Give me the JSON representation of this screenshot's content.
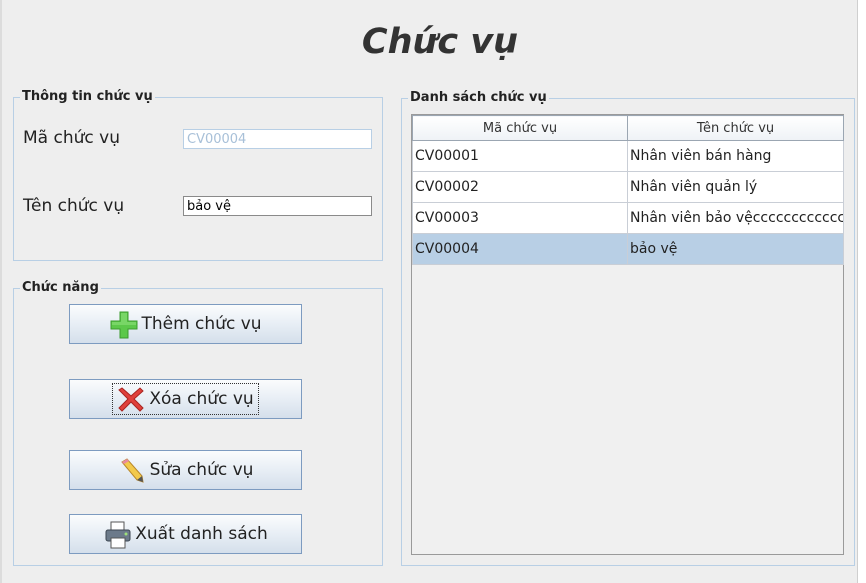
{
  "title": "Chức vụ",
  "info": {
    "group_title": "Thông tin chức vụ",
    "code_label": "Mã chức vụ",
    "code_value": "CV00004",
    "name_label": "Tên chức vụ",
    "name_value": "bảo vệ"
  },
  "functions": {
    "group_title": "Chức năng",
    "add_label": "Thêm chức vụ",
    "delete_label": "Xóa chức vụ",
    "edit_label": "Sửa chức vụ",
    "export_label": "Xuất danh sách"
  },
  "list": {
    "group_title": "Danh sách chức vụ",
    "columns": [
      "Mã chức vụ",
      "Tên chức vụ"
    ],
    "rows": [
      {
        "code": "CV00001",
        "name": "Nhân viên bán hàng",
        "selected": false
      },
      {
        "code": "CV00002",
        "name": "Nhân viên quản lý",
        "selected": false
      },
      {
        "code": "CV00003",
        "name": "Nhân viên bảo vệccccccccccccc",
        "selected": false
      },
      {
        "code": "CV00004",
        "name": "bảo vệ",
        "selected": true
      }
    ]
  },
  "icons": {
    "add": "plus-icon",
    "delete": "x-icon",
    "edit": "pencil-icon",
    "export": "printer-icon"
  },
  "colors": {
    "selection": "#b8cfe5",
    "group_border": "#b8cfe5",
    "add_icon": "#5cc84a",
    "delete_icon": "#e0403c"
  }
}
